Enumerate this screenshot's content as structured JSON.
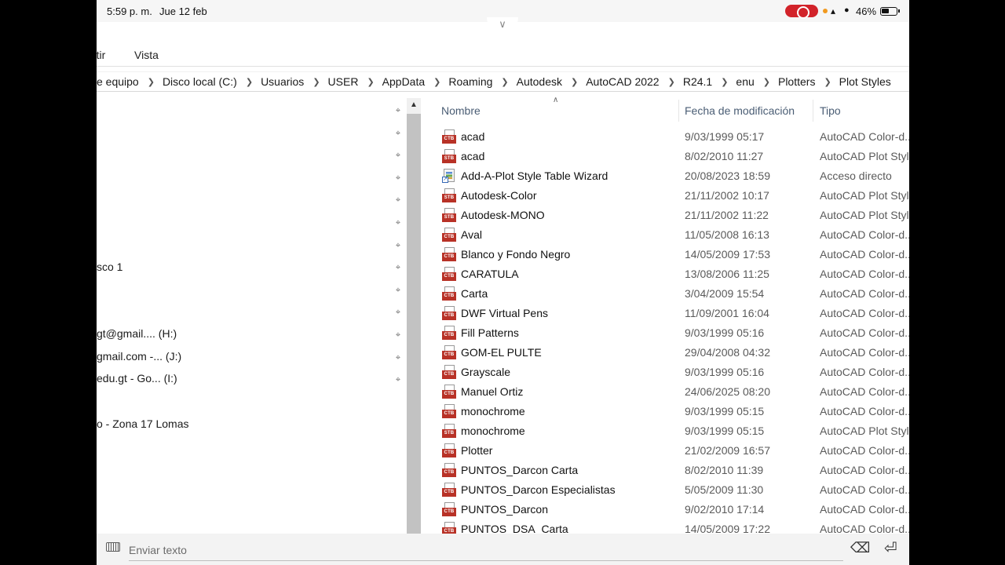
{
  "status_bar": {
    "time": "5:59 p. m.",
    "date": "Jue 12 feb",
    "battery": "46%"
  },
  "ribbon": {
    "tabs": [
      "rtir",
      "Vista"
    ]
  },
  "address_bar": {
    "crumbs": [
      "e equipo",
      "Disco local (C:)",
      "Usuarios",
      "USER",
      "AppData",
      "Roaming",
      "Autodesk",
      "AutoCAD 2022",
      "R24.1",
      "enu",
      "Plotters",
      "Plot Styles"
    ]
  },
  "nav_pane": {
    "items": [
      "sco 1",
      "gt@gmail.... (H:)",
      "gmail.com -... (J:)",
      "edu.gt - Go... (I:)",
      "o - Zona 17 Lomas"
    ]
  },
  "columns": {
    "name": "Nombre",
    "modified": "Fecha de modificación",
    "type": "Tipo"
  },
  "files": [
    {
      "name": "acad",
      "date": "9/03/1999 05:17",
      "type": "AutoCAD Color-d...",
      "icon": "CTB"
    },
    {
      "name": "acad",
      "date": "8/02/2010 11:27",
      "type": "AutoCAD Plot Style",
      "icon": "STB"
    },
    {
      "name": "Add-A-Plot Style Table Wizard",
      "date": "20/08/2023 18:59",
      "type": "Acceso directo",
      "icon": "LNK"
    },
    {
      "name": "Autodesk-Color",
      "date": "21/11/2002 10:17",
      "type": "AutoCAD Plot Style",
      "icon": "STB"
    },
    {
      "name": "Autodesk-MONO",
      "date": "21/11/2002 11:22",
      "type": "AutoCAD Plot Style",
      "icon": "STB"
    },
    {
      "name": "Aval",
      "date": "11/05/2008 16:13",
      "type": "AutoCAD Color-d...",
      "icon": "CTB"
    },
    {
      "name": "Blanco y Fondo Negro",
      "date": "14/05/2009 17:53",
      "type": "AutoCAD Color-d...",
      "icon": "CTB"
    },
    {
      "name": "CARATULA",
      "date": "13/08/2006 11:25",
      "type": "AutoCAD Color-d...",
      "icon": "CTB"
    },
    {
      "name": "Carta",
      "date": "3/04/2009 15:54",
      "type": "AutoCAD Color-d...",
      "icon": "CTB"
    },
    {
      "name": "DWF Virtual Pens",
      "date": "11/09/2001 16:04",
      "type": "AutoCAD Color-d...",
      "icon": "CTB"
    },
    {
      "name": "Fill Patterns",
      "date": "9/03/1999 05:16",
      "type": "AutoCAD Color-d...",
      "icon": "CTB"
    },
    {
      "name": "GOM-EL PULTE",
      "date": "29/04/2008 04:32",
      "type": "AutoCAD Color-d...",
      "icon": "CTB"
    },
    {
      "name": "Grayscale",
      "date": "9/03/1999 05:16",
      "type": "AutoCAD Color-d...",
      "icon": "CTB"
    },
    {
      "name": "Manuel Ortiz",
      "date": "24/06/2025 08:20",
      "type": "AutoCAD Color-d...",
      "icon": "CTB"
    },
    {
      "name": "monochrome",
      "date": "9/03/1999 05:15",
      "type": "AutoCAD Color-d...",
      "icon": "CTB"
    },
    {
      "name": "monochrome",
      "date": "9/03/1999 05:15",
      "type": "AutoCAD Plot Style",
      "icon": "STB"
    },
    {
      "name": "Plotter",
      "date": "21/02/2009 16:57",
      "type": "AutoCAD Color-d...",
      "icon": "CTB"
    },
    {
      "name": "PUNTOS_Darcon Carta",
      "date": "8/02/2010 11:39",
      "type": "AutoCAD Color-d...",
      "icon": "CTB"
    },
    {
      "name": "PUNTOS_Darcon Especialistas",
      "date": "5/05/2009 11:30",
      "type": "AutoCAD Color-d...",
      "icon": "CTB"
    },
    {
      "name": "PUNTOS_Darcon",
      "date": "9/02/2010 17:14",
      "type": "AutoCAD Color-d...",
      "icon": "CTB"
    },
    {
      "name": "PUNTOS_DSA_Carta",
      "date": "14/05/2009 17:22",
      "type": "AutoCAD Color-d...",
      "icon": "CTB"
    }
  ],
  "input_bar": {
    "placeholder": "Enviar texto"
  },
  "colors": {
    "badge_red": "#b83227",
    "record_red": "#d2232a",
    "header_text": "#4a5d74"
  }
}
